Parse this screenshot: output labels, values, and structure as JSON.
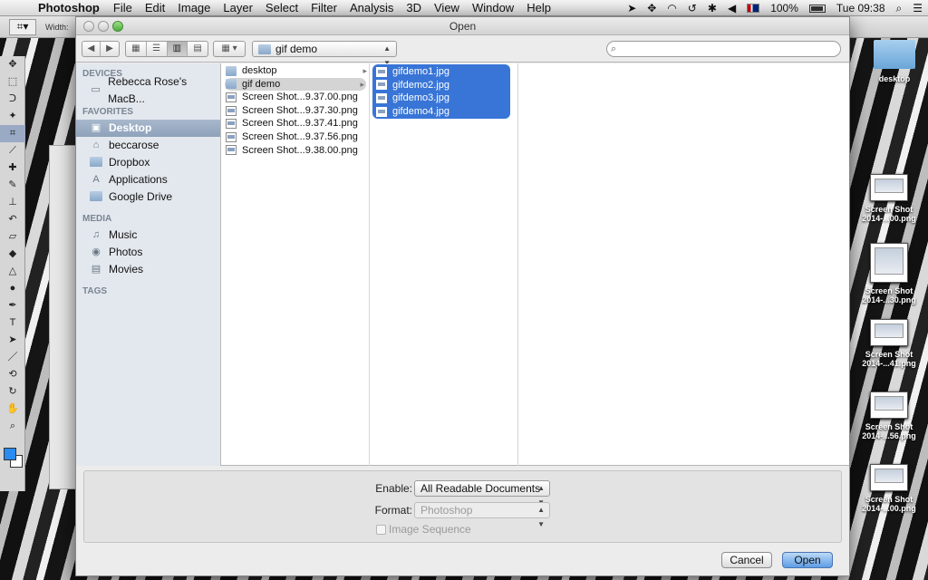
{
  "menubar": {
    "app_name": "Photoshop",
    "items": [
      "File",
      "Edit",
      "Image",
      "Layer",
      "Select",
      "Filter",
      "Analysis",
      "3D",
      "View",
      "Window",
      "Help"
    ],
    "battery": "100%",
    "clock": "Tue 09:38"
  },
  "ps_options": {
    "width_label": "Width:"
  },
  "dialog": {
    "title": "Open",
    "path_popup": "gif demo",
    "sidebar": {
      "devices_header": "DEVICES",
      "devices": [
        {
          "label": "Rebecca Rose's MacB...",
          "icon": "laptop-icon"
        }
      ],
      "favorites_header": "FAVORITES",
      "favorites": [
        {
          "label": "Desktop",
          "icon": "desktop-icon",
          "selected": true
        },
        {
          "label": "beccarose",
          "icon": "home-icon"
        },
        {
          "label": "Dropbox",
          "icon": "folder-icon"
        },
        {
          "label": "Applications",
          "icon": "applications-icon"
        },
        {
          "label": "Google Drive",
          "icon": "folder-icon"
        }
      ],
      "media_header": "MEDIA",
      "media": [
        {
          "label": "Music",
          "icon": "music-icon"
        },
        {
          "label": "Photos",
          "icon": "camera-icon"
        },
        {
          "label": "Movies",
          "icon": "film-icon"
        }
      ],
      "tags_header": "TAGS"
    },
    "column1": [
      {
        "label": "desktop",
        "type": "folder"
      },
      {
        "label": "gif demo",
        "type": "folder",
        "selected": true
      },
      {
        "label": "Screen Shot...9.37.00.png",
        "type": "file"
      },
      {
        "label": "Screen Shot...9.37.30.png",
        "type": "file"
      },
      {
        "label": "Screen Shot...9.37.41.png",
        "type": "file"
      },
      {
        "label": "Screen Shot...9.37.56.png",
        "type": "file"
      },
      {
        "label": "Screen Shot...9.38.00.png",
        "type": "file"
      }
    ],
    "column2": [
      {
        "label": "gifdemo1.jpg"
      },
      {
        "label": "gifdemo2.jpg"
      },
      {
        "label": "gifdemo3.jpg"
      },
      {
        "label": "gifdemo4.jpg"
      }
    ],
    "enable_label": "Enable:",
    "enable_value": "All Readable Documents",
    "format_label": "Format:",
    "format_value": "Photoshop",
    "image_sequence_label": "Image Sequence",
    "cancel_label": "Cancel",
    "open_label": "Open"
  },
  "desktop_icons": [
    {
      "label": "desktop",
      "type": "folder"
    },
    {
      "label": "Screen Shot 2014-...00.png",
      "type": "thumb"
    },
    {
      "label": "Screen Shot 2014-...30.png",
      "type": "thumb"
    },
    {
      "label": "Screen Shot 2014-...41.png",
      "type": "thumb"
    },
    {
      "label": "Screen Shot 2014-...56.png",
      "type": "thumb"
    },
    {
      "label": "Screen Shot 2014-...00.png",
      "type": "thumb"
    }
  ],
  "colors": {
    "selection": "#3875d7",
    "sidebar_bg": "#e3e8ee",
    "ps_foreground": "#2a8cf0"
  }
}
